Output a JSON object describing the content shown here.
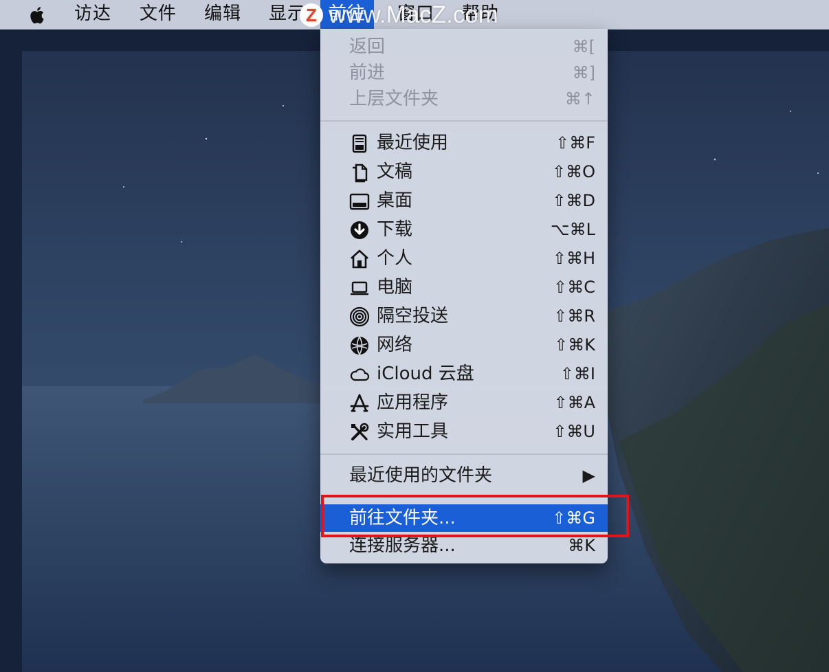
{
  "menubar": {
    "apple_icon": "apple-logo-icon",
    "items": [
      "访达",
      "文件",
      "编辑",
      "显示",
      "前往",
      "窗口",
      "帮助"
    ],
    "active_index": 4
  },
  "watermark": {
    "logo_letter": "Z",
    "text": "www.MacZ.com"
  },
  "menu": {
    "nav_items": [
      {
        "label": "返回",
        "shortcut": "⌘[",
        "disabled": true
      },
      {
        "label": "前进",
        "shortcut": "⌘]",
        "disabled": true
      },
      {
        "label": "上层文件夹",
        "shortcut": "⌘↑",
        "disabled": true
      }
    ],
    "location_items": [
      {
        "label": "最近使用",
        "shortcut": "⇧⌘F",
        "icon": "recents-icon"
      },
      {
        "label": "文稿",
        "shortcut": "⇧⌘O",
        "icon": "documents-icon"
      },
      {
        "label": "桌面",
        "shortcut": "⇧⌘D",
        "icon": "desktop-icon"
      },
      {
        "label": "下载",
        "shortcut": "⌥⌘L",
        "icon": "downloads-icon"
      },
      {
        "label": "个人",
        "shortcut": "⇧⌘H",
        "icon": "home-icon"
      },
      {
        "label": "电脑",
        "shortcut": "⇧⌘C",
        "icon": "computer-icon"
      },
      {
        "label": "隔空投送",
        "shortcut": "⇧⌘R",
        "icon": "airdrop-icon"
      },
      {
        "label": "网络",
        "shortcut": "⇧⌘K",
        "icon": "network-icon"
      },
      {
        "label": "iCloud 云盘",
        "shortcut": "⇧⌘I",
        "icon": "icloud-icon"
      },
      {
        "label": "应用程序",
        "shortcut": "⇧⌘A",
        "icon": "applications-icon"
      },
      {
        "label": "实用工具",
        "shortcut": "⇧⌘U",
        "icon": "utilities-icon"
      }
    ],
    "recent_folders": {
      "label": "最近使用的文件夹",
      "arrow": "▶"
    },
    "goto_folder": {
      "label": "前往文件夹...",
      "shortcut": "⇧⌘G",
      "selected": true
    },
    "connect_server": {
      "label": "连接服务器...",
      "shortcut": "⌘K"
    }
  },
  "colors": {
    "accent": "#1b5fd6",
    "annotation_box": "#e0151b"
  }
}
